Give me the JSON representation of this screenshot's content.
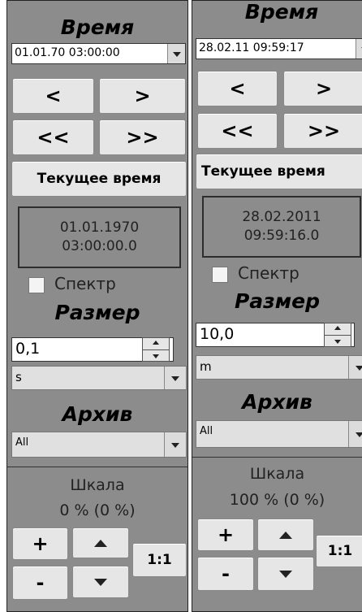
{
  "panels": [
    {
      "time_title": "Время",
      "datetime_value": "01.01.70 03:00:00",
      "btn_prev": "<",
      "btn_next": ">",
      "btn_prev_fast": "<<",
      "btn_next_fast": ">>",
      "btn_current_time": "Текущее время",
      "readout_date": "01.01.1970",
      "readout_time": "03:00:00.0",
      "spectrum_label": "Спектр",
      "spectrum_checked": false,
      "size_title": "Размер",
      "size_value": "0,1",
      "unit_value": "s",
      "archive_title": "Архив",
      "archive_value": "All",
      "scale_label": "Шкала",
      "scale_value": "0 % (0 %)",
      "btn_plus": "+",
      "btn_minus": "-",
      "btn_one_to_one": "1:1"
    },
    {
      "time_title": "Время",
      "datetime_value": "28.02.11 09:59:17",
      "btn_prev": "<",
      "btn_next": ">",
      "btn_prev_fast": "<<",
      "btn_next_fast": ">>",
      "btn_current_time": "Текущее время",
      "readout_date": "28.02.2011",
      "readout_time": "09:59:16.0",
      "spectrum_label": "Спектр",
      "spectrum_checked": false,
      "size_title": "Размер",
      "size_value": "10,0",
      "unit_value": "m",
      "archive_title": "Архив",
      "archive_value": "All",
      "scale_label": "Шкала",
      "scale_value": "100 % (0 %)",
      "btn_plus": "+",
      "btn_minus": "-",
      "btn_one_to_one": "1:1"
    }
  ]
}
